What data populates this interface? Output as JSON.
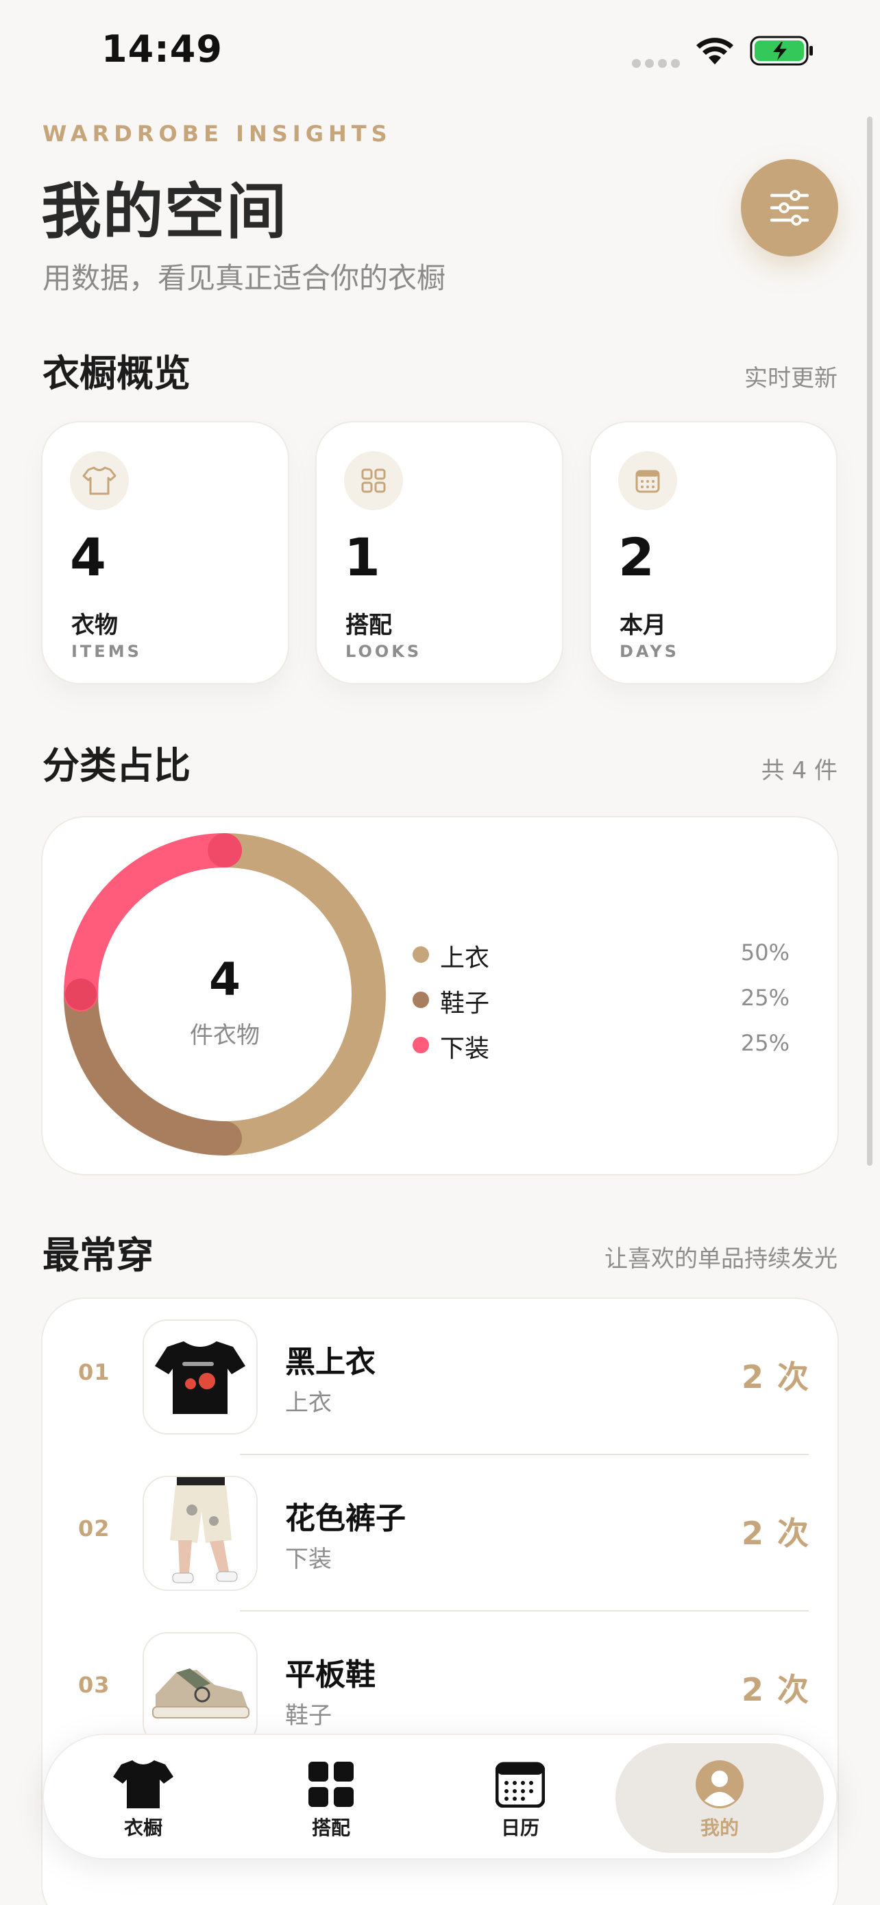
{
  "status": {
    "time": "14:49"
  },
  "header": {
    "eyebrow": "WARDROBE INSIGHTS",
    "title": "我的空间",
    "subtitle": "用数据，看见真正适合你的衣橱"
  },
  "overview": {
    "title": "衣橱概览",
    "meta": "实时更新",
    "cards": [
      {
        "icon": "tshirt-icon",
        "value": "4",
        "label": "衣物",
        "sub": "ITEMS"
      },
      {
        "icon": "grid-icon",
        "value": "1",
        "label": "搭配",
        "sub": "LOOKS"
      },
      {
        "icon": "calendar-icon",
        "value": "2",
        "label": "本月",
        "sub": "DAYS"
      }
    ]
  },
  "category": {
    "title": "分类占比",
    "meta": "共 4 件",
    "center_value": "4",
    "center_label": "件衣物",
    "items": [
      {
        "label": "上衣",
        "pct": "50%",
        "value": 50,
        "color": "#c6a57b"
      },
      {
        "label": "鞋子",
        "pct": "25%",
        "value": 25,
        "color": "#a97e5e"
      },
      {
        "label": "下装",
        "pct": "25%",
        "value": 25,
        "color": "#ff5c7c"
      }
    ]
  },
  "most_worn": {
    "title": "最常穿",
    "meta": "让喜欢的单品持续发光",
    "items": [
      {
        "rank": "01",
        "name": "黑上衣",
        "category": "上衣",
        "count": "2 次"
      },
      {
        "rank": "02",
        "name": "花色裤子",
        "category": "下装",
        "count": "2 次"
      },
      {
        "rank": "03",
        "name": "平板鞋",
        "category": "鞋子",
        "count": "2 次"
      }
    ]
  },
  "tabs": [
    {
      "label": "衣橱",
      "icon": "tshirt-icon",
      "active": false
    },
    {
      "label": "搭配",
      "icon": "grid-icon",
      "active": false
    },
    {
      "label": "日历",
      "icon": "calendar-icon",
      "active": false
    },
    {
      "label": "我的",
      "icon": "profile-icon",
      "active": true
    }
  ],
  "colors": {
    "accent": "#c6a57b",
    "pink": "#ff5c7c",
    "brown": "#a97e5e",
    "background": "#f8f7f5"
  }
}
